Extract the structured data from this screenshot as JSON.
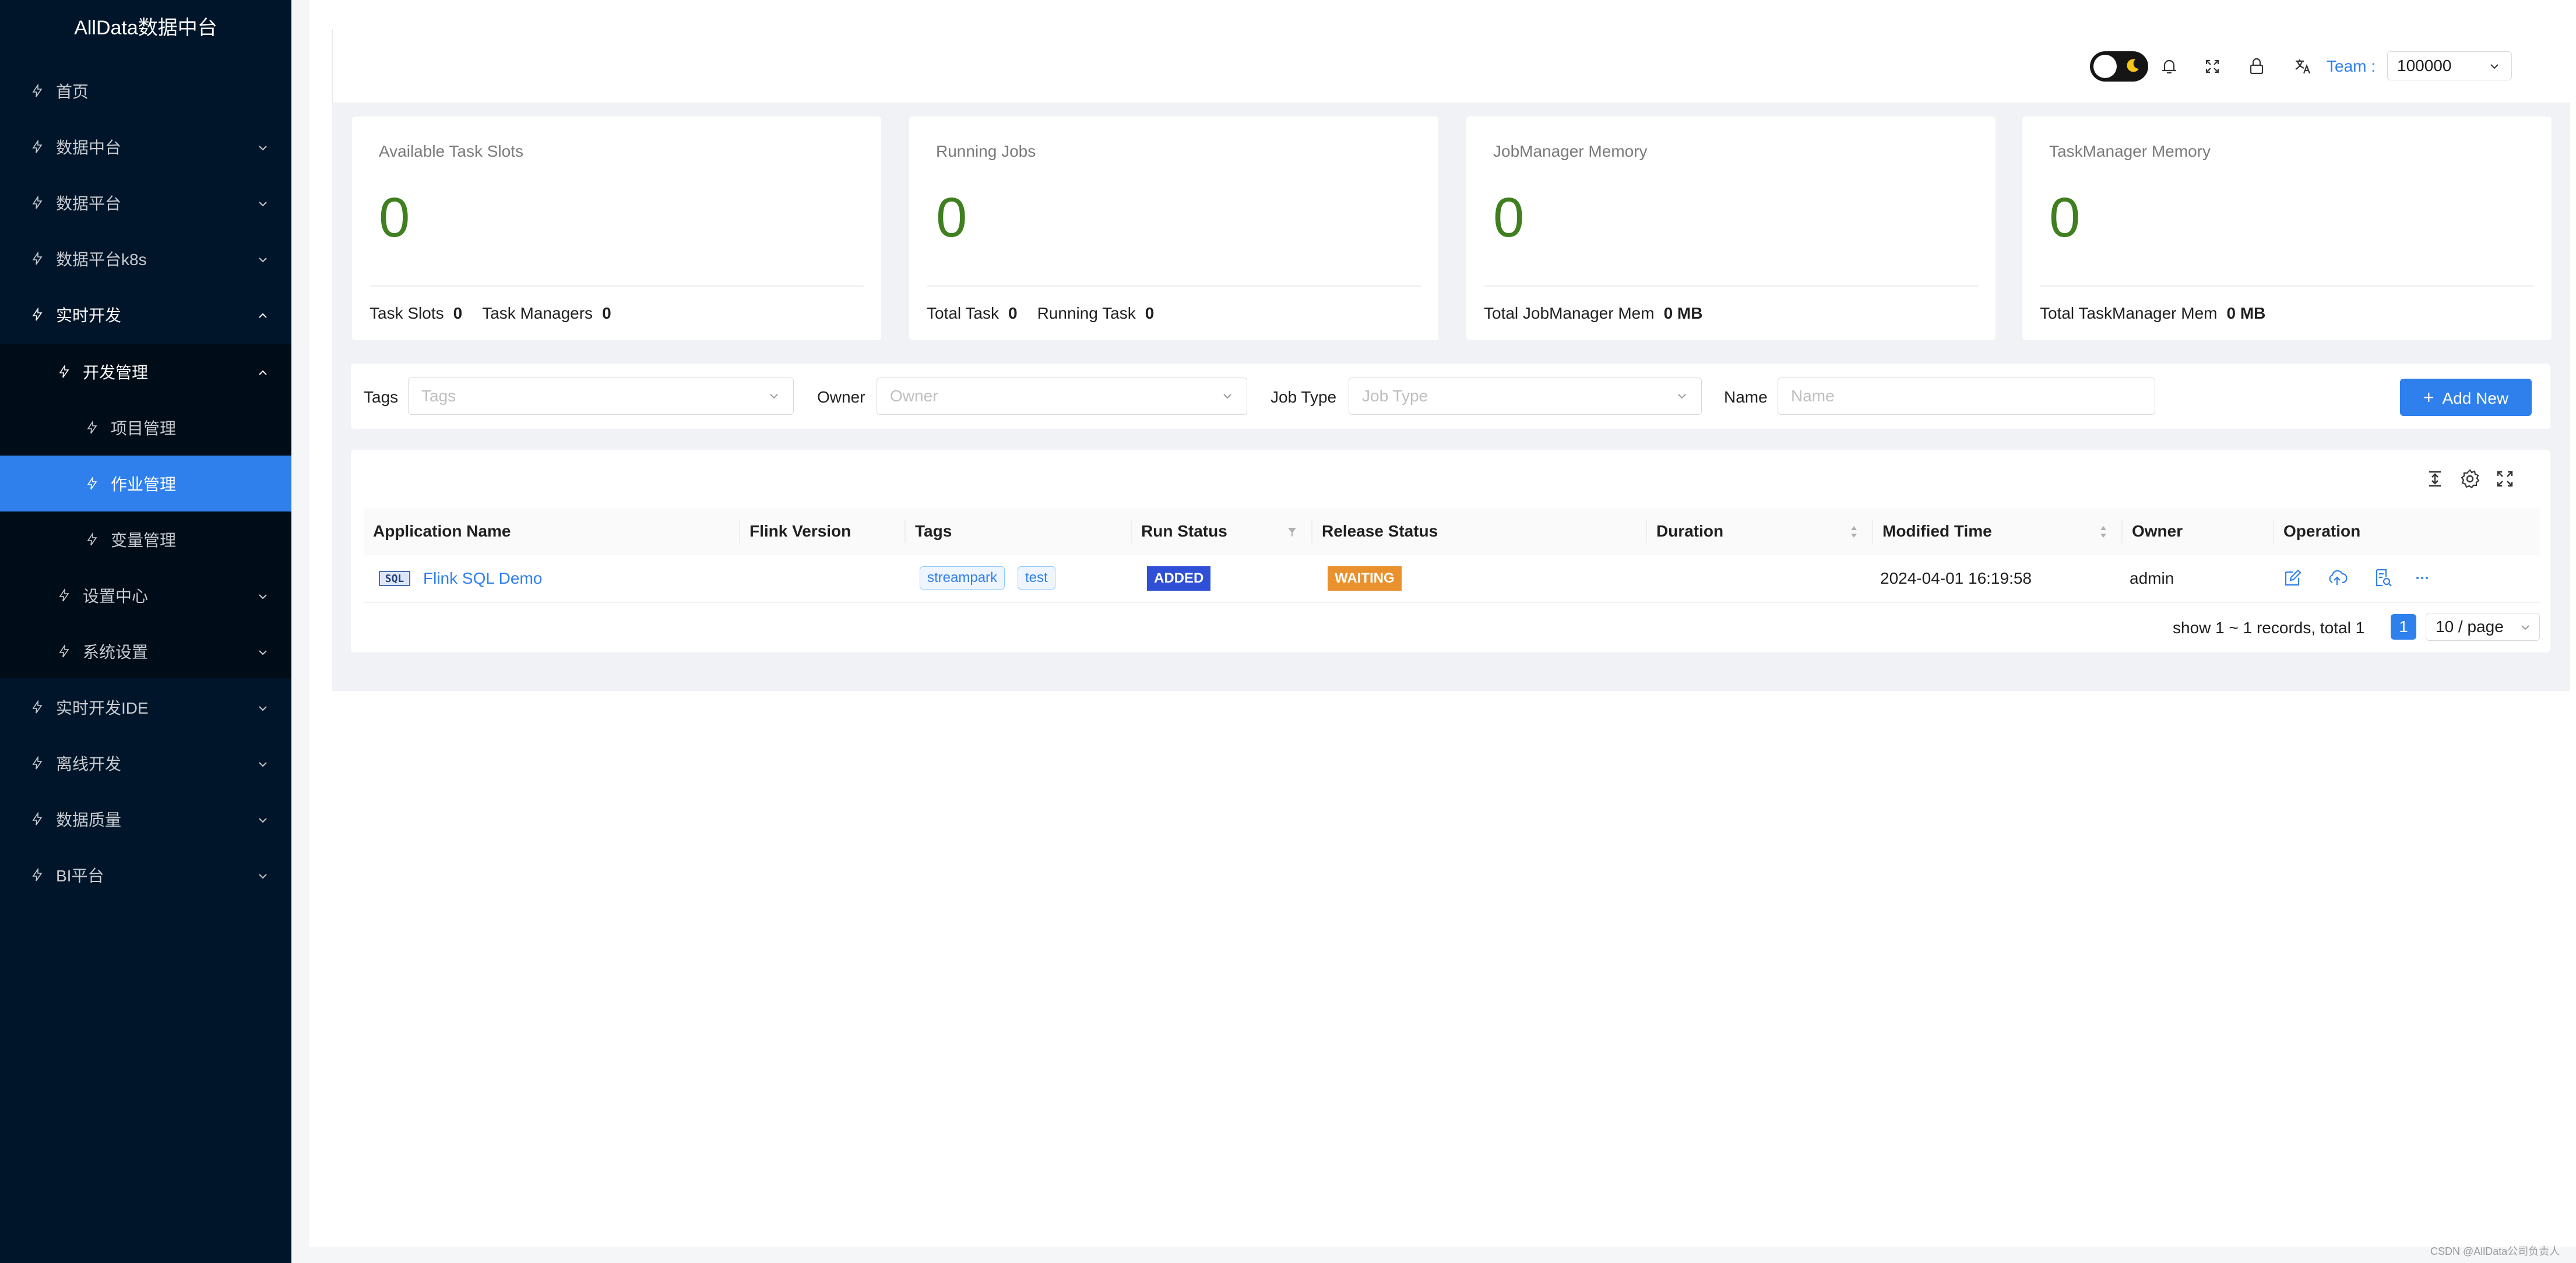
{
  "app": {
    "title": "AllData数据中台"
  },
  "sidebar": {
    "items": [
      {
        "label": "首页"
      },
      {
        "label": "数据中台"
      },
      {
        "label": "数据平台"
      },
      {
        "label": "数据平台k8s"
      },
      {
        "label": "实时开发"
      },
      {
        "label": "开发管理"
      },
      {
        "label": "项目管理"
      },
      {
        "label": "作业管理"
      },
      {
        "label": "变量管理"
      },
      {
        "label": "设置中心"
      },
      {
        "label": "系统设置"
      },
      {
        "label": "实时开发IDE"
      },
      {
        "label": "离线开发"
      },
      {
        "label": "数据质量"
      },
      {
        "label": "BI平台"
      }
    ]
  },
  "header": {
    "team_label": "Team :",
    "team_value": "100000",
    "icons": [
      "theme-toggle",
      "bell-icon",
      "fullscreen-icon",
      "lock-icon",
      "translate-icon"
    ]
  },
  "stats": [
    {
      "title": "Available Task Slots",
      "value": "0",
      "foot": [
        {
          "label": "Task Slots",
          "value": "0"
        },
        {
          "label": "Task Managers",
          "value": "0"
        }
      ]
    },
    {
      "title": "Running Jobs",
      "value": "0",
      "foot": [
        {
          "label": "Total Task",
          "value": "0"
        },
        {
          "label": "Running Task",
          "value": "0"
        }
      ]
    },
    {
      "title": "JobManager Memory",
      "value": "0",
      "foot": [
        {
          "label": "Total JobManager Mem",
          "value": "0 MB"
        }
      ]
    },
    {
      "title": "TaskManager Memory",
      "value": "0",
      "foot": [
        {
          "label": "Total TaskManager Mem",
          "value": "0 MB"
        }
      ]
    }
  ],
  "search": {
    "tags_label": "Tags",
    "tags_placeholder": "Tags",
    "owner_label": "Owner",
    "owner_placeholder": "Owner",
    "jobtype_label": "Job Type",
    "jobtype_placeholder": "Job Type",
    "name_label": "Name",
    "name_placeholder": "Name",
    "add_label": "Add New"
  },
  "table": {
    "columns": [
      "Application Name",
      "Flink Version",
      "Tags",
      "Run Status",
      "Release Status",
      "Duration",
      "Modified Time",
      "Owner",
      "Operation"
    ],
    "rows": [
      {
        "type_badge": "SQL",
        "name": "Flink SQL Demo",
        "flink_version": "",
        "tags": [
          "streampark",
          "test"
        ],
        "run_status": "ADDED",
        "release_status": "WAITING",
        "duration": "",
        "modified": "2024-04-01 16:19:58",
        "owner": "admin"
      }
    ],
    "pagination": {
      "summary": "show 1 ~ 1 records, total 1",
      "current": "1",
      "page_size": "10 / page"
    }
  },
  "colors": {
    "sidebar": "#001529",
    "accent": "#2f80ed",
    "stat_value": "#3f7f1f",
    "added": "#2f4fd6",
    "waiting": "#e8912d"
  },
  "watermark": "CSDN @AllData公司负责人"
}
